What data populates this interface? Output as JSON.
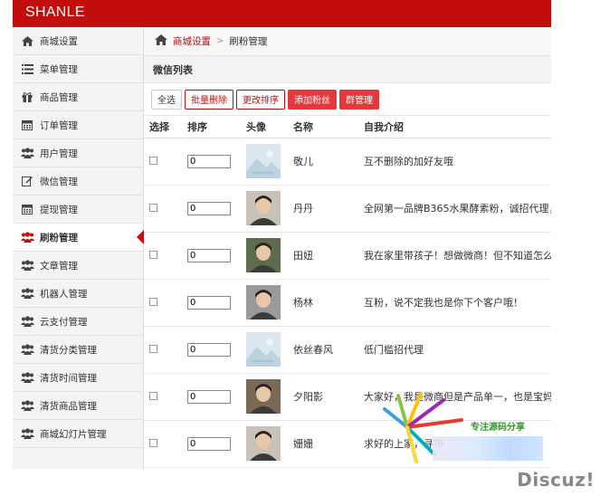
{
  "app": {
    "brand": "SHANLE"
  },
  "sidebar": {
    "items": [
      {
        "label": "商城设置",
        "icon": "home-icon",
        "active": false
      },
      {
        "label": "菜单管理",
        "icon": "list-icon",
        "active": false
      },
      {
        "label": "商品管理",
        "icon": "gift-icon",
        "active": false
      },
      {
        "label": "订单管理",
        "icon": "calendar-icon",
        "active": false
      },
      {
        "label": "用户管理",
        "icon": "users-icon",
        "active": false
      },
      {
        "label": "微信管理",
        "icon": "edit-icon",
        "active": false
      },
      {
        "label": "提现管理",
        "icon": "calendar-icon",
        "active": false
      },
      {
        "label": "刷粉管理",
        "icon": "users-icon",
        "active": true
      },
      {
        "label": "文章管理",
        "icon": "users-icon",
        "active": false
      },
      {
        "label": "机器人管理",
        "icon": "users-icon",
        "active": false
      },
      {
        "label": "云支付管理",
        "icon": "users-icon",
        "active": false
      },
      {
        "label": "清货分类管理",
        "icon": "users-icon",
        "active": false
      },
      {
        "label": "清货时间管理",
        "icon": "users-icon",
        "active": false
      },
      {
        "label": "清货商品管理",
        "icon": "users-icon",
        "active": false
      },
      {
        "label": "商城幻灯片管理",
        "icon": "users-icon",
        "active": false
      }
    ]
  },
  "breadcrumb": {
    "link": "商城设置",
    "separator": ">",
    "current": "刷粉管理"
  },
  "panel": {
    "title": "微信列表"
  },
  "toolbar": {
    "select_all": "全选",
    "batch_delete": "批量删除",
    "change_sort": "更改排序",
    "add_fans": "添加粉丝",
    "group_manage": "群管理"
  },
  "table": {
    "headers": [
      "选择",
      "排序",
      "头像",
      "名称",
      "自我介绍"
    ],
    "rows": [
      {
        "sort": "0",
        "avatar": "placeholder",
        "name": "敬儿",
        "intro": "互不删除的加好友哦"
      },
      {
        "sort": "0",
        "avatar": "photo",
        "name": "丹丹",
        "intro": "全网第一品牌B365水果酵素粉，诚招代理，"
      },
      {
        "sort": "0",
        "avatar": "photo",
        "name": "田妞",
        "intro": "我在家里带孩子！想做微商！但不知道怎么"
      },
      {
        "sort": "0",
        "avatar": "photo",
        "name": "杨林",
        "intro": "互粉，说不定我也是你下个客户哦！"
      },
      {
        "sort": "0",
        "avatar": "placeholder",
        "name": "依丝春风",
        "intro": "低门槛招代理"
      },
      {
        "sort": "0",
        "avatar": "photo",
        "name": "夕阳影",
        "intro": "大家好，我是微商但是产品单一，也是宝妈"
      },
      {
        "sort": "0",
        "avatar": "photo",
        "name": "姗姗",
        "intro": "求好的上家，寻带"
      }
    ]
  },
  "watermark": {
    "text": "Discuz!",
    "tagline": "专注源码分享"
  },
  "colors": {
    "brand_red": "#c30d0d",
    "button_red": "#e4393c"
  }
}
